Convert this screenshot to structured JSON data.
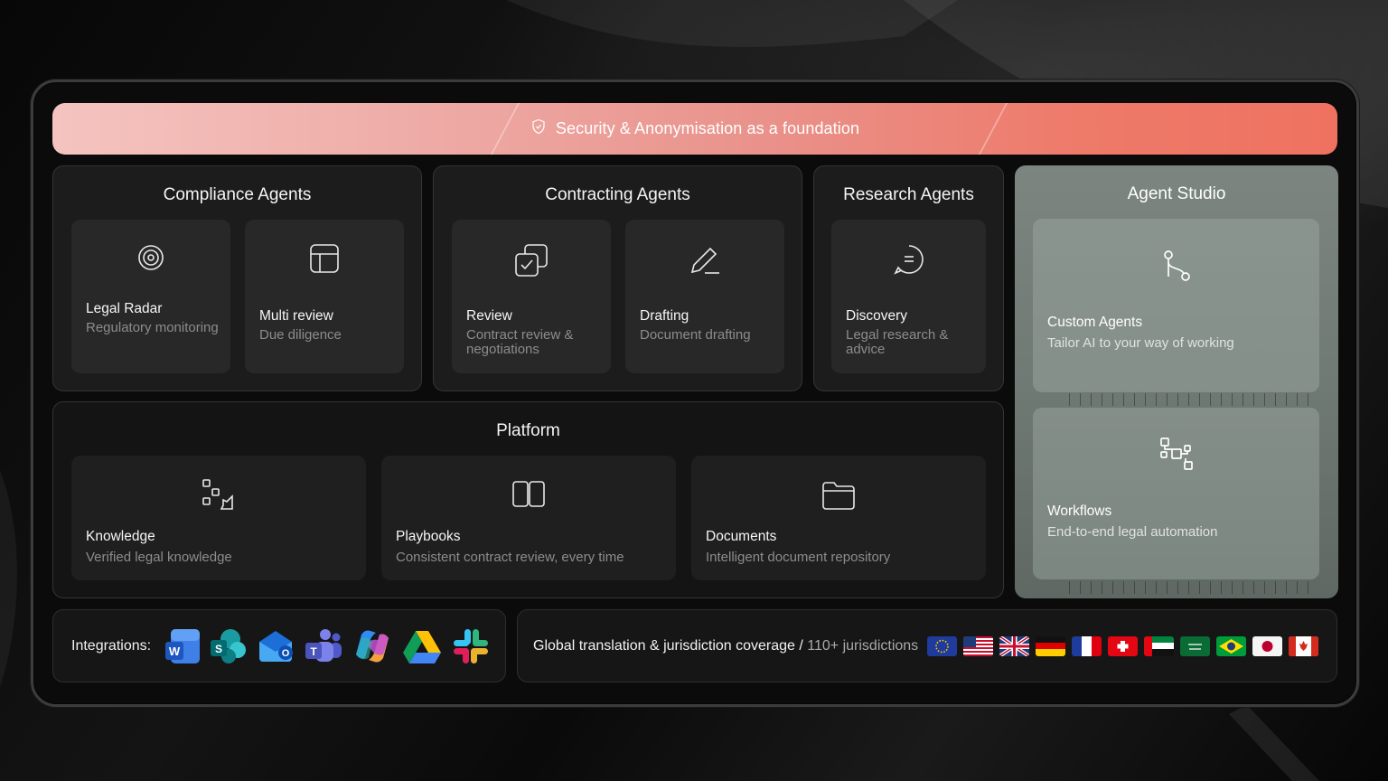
{
  "banner": {
    "text": "Security & Anonymisation as a foundation",
    "icon": "shield-check-icon"
  },
  "compliance": {
    "title": "Compliance Agents",
    "cards": [
      {
        "name": "Legal Radar",
        "desc": "Regulatory monitoring",
        "icon": "radar-target-icon"
      },
      {
        "name": "Multi review",
        "desc": "Due diligence",
        "icon": "grid-layout-icon"
      }
    ]
  },
  "contracting": {
    "title": "Contracting Agents",
    "cards": [
      {
        "name": "Review",
        "desc": "Contract review & negotiations",
        "icon": "checkbox-copy-icon"
      },
      {
        "name": "Drafting",
        "desc": "Document drafting",
        "icon": "pencil-icon"
      }
    ]
  },
  "research": {
    "title": "Research Agents",
    "cards": [
      {
        "name": "Discovery",
        "desc": "Legal research & advice",
        "icon": "chat-bubble-icon"
      }
    ]
  },
  "studio": {
    "title": "Agent Studio",
    "cards": [
      {
        "name": "Custom Agents",
        "desc": "Tailor AI to your way of working",
        "icon": "git-branch-icon"
      },
      {
        "name": "Workflows",
        "desc": "End-to-end legal automation",
        "icon": "workflow-icon"
      }
    ]
  },
  "platform": {
    "title": "Platform",
    "cards": [
      {
        "name": "Knowledge",
        "desc": "Verified legal knowledge",
        "icon": "knowledge-nodes-icon"
      },
      {
        "name": "Playbooks",
        "desc": "Consistent contract review, every time",
        "icon": "open-book-icon"
      },
      {
        "name": "Documents",
        "desc": "Intelligent document repository",
        "icon": "folder-icon"
      }
    ]
  },
  "integrations": {
    "label": "Integrations:",
    "apps": [
      {
        "name": "Word",
        "letter": "W",
        "icon": "word-icon"
      },
      {
        "name": "SharePoint",
        "letter": "S",
        "icon": "sharepoint-icon"
      },
      {
        "name": "Outlook",
        "letter": "O",
        "icon": "outlook-icon"
      },
      {
        "name": "Teams",
        "letter": "T",
        "icon": "teams-icon"
      },
      {
        "name": "Copilot",
        "icon": "copilot-icon"
      },
      {
        "name": "Google Drive",
        "icon": "google-drive-icon"
      },
      {
        "name": "Slack",
        "icon": "slack-icon"
      }
    ]
  },
  "coverage": {
    "text": "Global translation & jurisdiction coverage /",
    "count": "110+ jurisdictions",
    "flags": [
      "eu-flag-icon",
      "us-flag-icon",
      "uk-flag-icon",
      "de-flag-icon",
      "fr-flag-icon",
      "ch-flag-icon",
      "ae-flag-icon",
      "sa-flag-icon",
      "br-flag-icon",
      "jp-flag-icon",
      "ca-flag-icon"
    ]
  },
  "colors": {
    "banner_start": "#f5c4c0",
    "banner_end": "#ef7260",
    "studio_bg": "#76807b"
  }
}
